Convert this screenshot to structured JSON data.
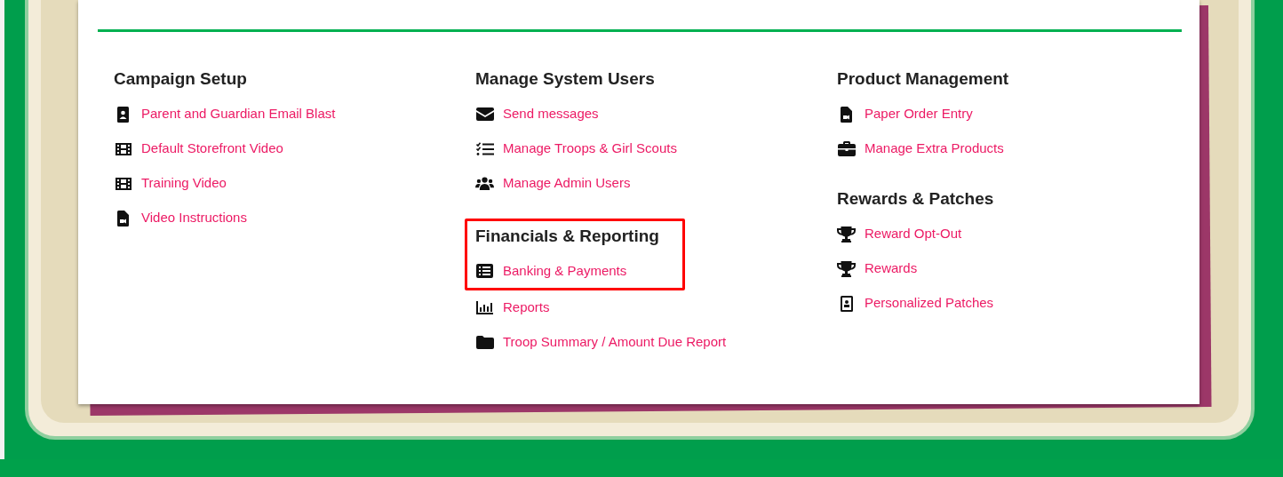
{
  "columns": [
    {
      "sections": [
        {
          "heading": "Campaign Setup",
          "highlighted": false,
          "items": [
            {
              "label": "Parent and Guardian Email Blast",
              "kind": "contact"
            },
            {
              "label": "Default Storefront Video",
              "kind": "film"
            },
            {
              "label": "Training Video",
              "kind": "film"
            },
            {
              "label": "Video Instructions",
              "kind": "filevideo"
            }
          ]
        }
      ]
    },
    {
      "sections": [
        {
          "heading": "Manage System Users",
          "highlighted": false,
          "items": [
            {
              "label": "Send messages",
              "kind": "envelope"
            },
            {
              "label": "Manage Troops & Girl Scouts",
              "kind": "checklist"
            },
            {
              "label": "Manage Admin Users",
              "kind": "users"
            }
          ]
        },
        {
          "heading": "Financials & Reporting",
          "highlighted": true,
          "items": [
            {
              "label": "Banking & Payments",
              "kind": "listalt"
            },
            {
              "label": "Reports",
              "kind": "chart"
            },
            {
              "label": "Troop Summary / Amount Due Report",
              "kind": "folder"
            }
          ]
        }
      ]
    },
    {
      "sections": [
        {
          "heading": "Product Management",
          "highlighted": false,
          "items": [
            {
              "label": "Paper Order Entry",
              "kind": "filevideo"
            },
            {
              "label": "Manage Extra Products",
              "kind": "briefcase"
            }
          ]
        },
        {
          "heading": "Rewards & Patches",
          "highlighted": false,
          "items": [
            {
              "label": "Reward Opt-Out",
              "kind": "trophy"
            },
            {
              "label": "Rewards",
              "kind": "trophy"
            },
            {
              "label": "Personalized Patches",
              "kind": "portrait"
            }
          ]
        }
      ]
    }
  ]
}
